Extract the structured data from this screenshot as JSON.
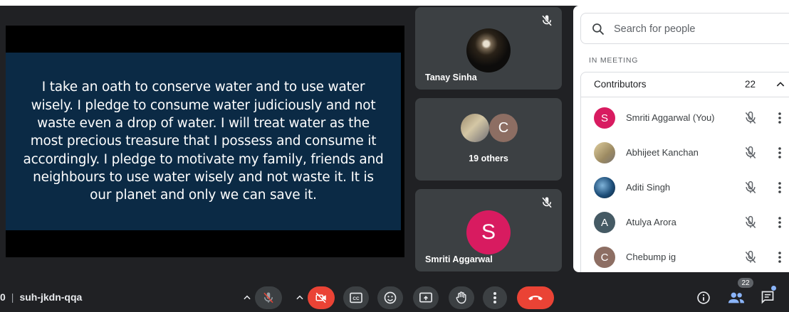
{
  "presentation": {
    "text": "I take an oath to conserve water and to use water wisely. I pledge to consume water judiciously and not waste even a drop of water. I will treat water as the most precious treasure that I possess and consume it accordingly. I pledge to motivate my family, friends and neighbours to use water wisely and not waste it. It is our planet and only we can save it."
  },
  "tiles": [
    {
      "name": "Tanay Sinha",
      "muted": true
    },
    {
      "avatar_letter": "C",
      "label": "19 others"
    },
    {
      "name": "Smriti Aggarwal",
      "avatar_letter": "S",
      "muted": true
    }
  ],
  "people_panel": {
    "search_placeholder": "Search for people",
    "section_label": "IN MEETING",
    "group_label": "Contributors",
    "group_count": "22",
    "people": [
      {
        "name": "Smriti Aggarwal (You)",
        "avatar_letter": "S",
        "avatar_color": "#d81b60"
      },
      {
        "name": "Abhijeet Kanchan",
        "avatar_letter": "",
        "avatar_color": "#b8a27a"
      },
      {
        "name": "Aditi Singh",
        "avatar_letter": "",
        "avatar_color": "#1e4f7a"
      },
      {
        "name": "Atulya Arora",
        "avatar_letter": "A",
        "avatar_color": "#455a64"
      },
      {
        "name": "Chebump ig",
        "avatar_letter": "C",
        "avatar_color": "#8d6e63"
      }
    ]
  },
  "bottom_bar": {
    "time_fragment": "0",
    "meeting_code": "suh-jkdn-qqa",
    "people_badge": "22",
    "icons": [
      "chevron-up-icon",
      "mic-off-icon",
      "chevron-up-icon",
      "camera-off-icon",
      "captions-icon",
      "emoji-icon",
      "present-icon",
      "raise-hand-icon",
      "more-vert-icon",
      "end-call-icon",
      "info-icon",
      "people-icon",
      "chat-icon"
    ]
  },
  "colors": {
    "background": "#202124",
    "tile": "#3c4043",
    "slide": "#0b2a45",
    "red": "#ea4335",
    "accent": "#8ab4f8"
  }
}
